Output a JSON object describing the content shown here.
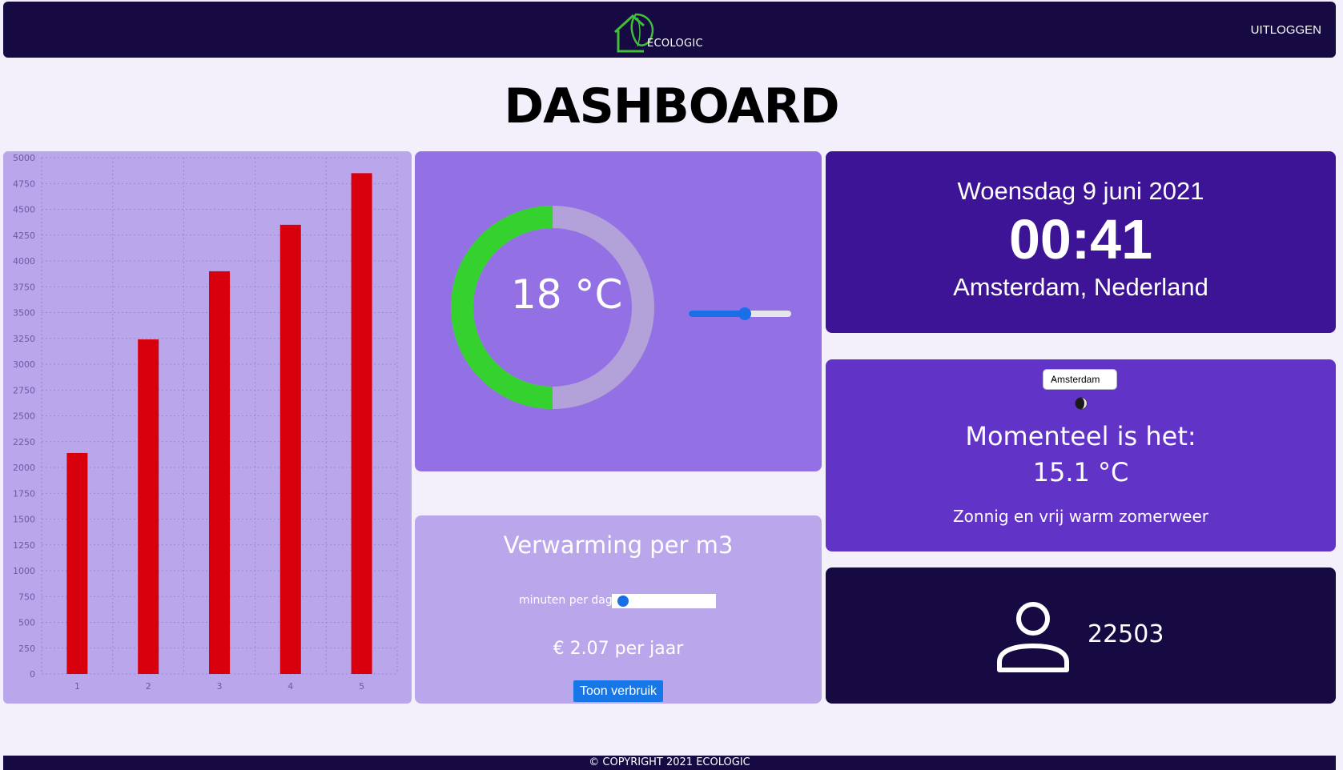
{
  "header": {
    "logo_text": "ECOLOGIC",
    "logout_label": "UITLOGGEN"
  },
  "page": {
    "title": "DASHBOARD"
  },
  "chart_data": {
    "type": "bar",
    "categories": [
      "1",
      "2",
      "3",
      "4",
      "5"
    ],
    "values": [
      2140,
      3240,
      3900,
      4350,
      4850
    ],
    "ylim": [
      0,
      5000
    ],
    "yticks": [
      0,
      250,
      500,
      750,
      1000,
      1250,
      1500,
      1750,
      2000,
      2250,
      2500,
      2750,
      3000,
      3250,
      3500,
      3750,
      4000,
      4250,
      4500,
      4750,
      5000
    ],
    "grid": true,
    "bar_color": "#d8000c"
  },
  "thermostat": {
    "value_text": "18 °C",
    "gauge_fraction": 0.5,
    "slider_fraction": 0.55,
    "gauge_color": "#34d12f",
    "track_color": "#b3a1d9"
  },
  "heating": {
    "title": "Verwarming per m3",
    "minutes_label": "minuten per dag: 0",
    "minutes_value": 0,
    "cost_text": "€ 2.07 per jaar",
    "button_label": "Toon verbruik"
  },
  "clock": {
    "date": "Woensdag 9 juni 2021",
    "time": "00:41",
    "location": "Amsterdam, Nederland"
  },
  "weather": {
    "city_selected": "Amsterdam",
    "icon": "moon-icon",
    "lead": "Momenteel is het:",
    "temperature": "15.1 °C",
    "description": "Zonnig en vrij warm zomerweer"
  },
  "users": {
    "icon": "user-icon",
    "count": "22503"
  },
  "footer": {
    "text": "© COPYRIGHT 2021 ECOLOGIC"
  }
}
